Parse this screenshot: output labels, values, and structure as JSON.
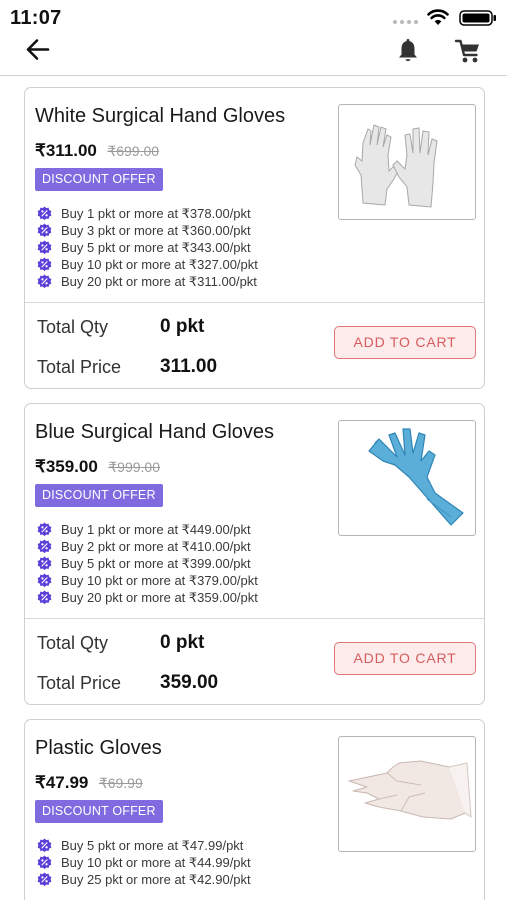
{
  "status_bar": {
    "time": "11:07"
  },
  "colors": {
    "badge": "#7f6bdf",
    "offer_icon": "#5b3fd8",
    "add_to_cart_border": "#e0787b",
    "add_to_cart_text": "#d85b5f"
  },
  "icons": {
    "back": "back-arrow-icon",
    "bell": "bell-icon",
    "cart": "shopping-cart-icon",
    "offer": "discount-percent-icon"
  },
  "products": [
    {
      "title": "White Surgical Hand Gloves",
      "price": "₹311.00",
      "mrp": "₹699.00",
      "badge": "DISCOUNT OFFER",
      "offers": [
        "Buy 1 pkt or more at ₹378.00/pkt",
        "Buy 3 pkt or more at ₹360.00/pkt",
        "Buy 5 pkt or more at ₹343.00/pkt",
        "Buy 10 pkt or more at ₹327.00/pkt",
        "Buy 20 pkt or more at ₹311.00/pkt"
      ],
      "total_qty_label": "Total Qty",
      "total_qty": "0 pkt",
      "total_price_label": "Total Price",
      "total_price": "311.00",
      "add_to_cart": "ADD TO CART"
    },
    {
      "title": "Blue Surgical Hand Gloves",
      "price": "₹359.00",
      "mrp": "₹999.00",
      "badge": "DISCOUNT OFFER",
      "offers": [
        "Buy 1 pkt or more at ₹449.00/pkt",
        "Buy 2 pkt or more at ₹410.00/pkt",
        "Buy 5 pkt or more at ₹399.00/pkt",
        "Buy 10 pkt or more at ₹379.00/pkt",
        "Buy 20 pkt or more at ₹359.00/pkt"
      ],
      "total_qty_label": "Total Qty",
      "total_qty": "0 pkt",
      "total_price_label": "Total Price",
      "total_price": "359.00",
      "add_to_cart": "ADD TO CART"
    },
    {
      "title": "Plastic Gloves",
      "price": "₹47.99",
      "mrp": "₹69.99",
      "badge": "DISCOUNT OFFER",
      "offers": [
        "Buy 5 pkt or more at ₹47.99/pkt",
        "Buy 10 pkt or more at ₹44.99/pkt",
        "Buy 25 pkt or more at ₹42.90/pkt"
      ]
    }
  ]
}
